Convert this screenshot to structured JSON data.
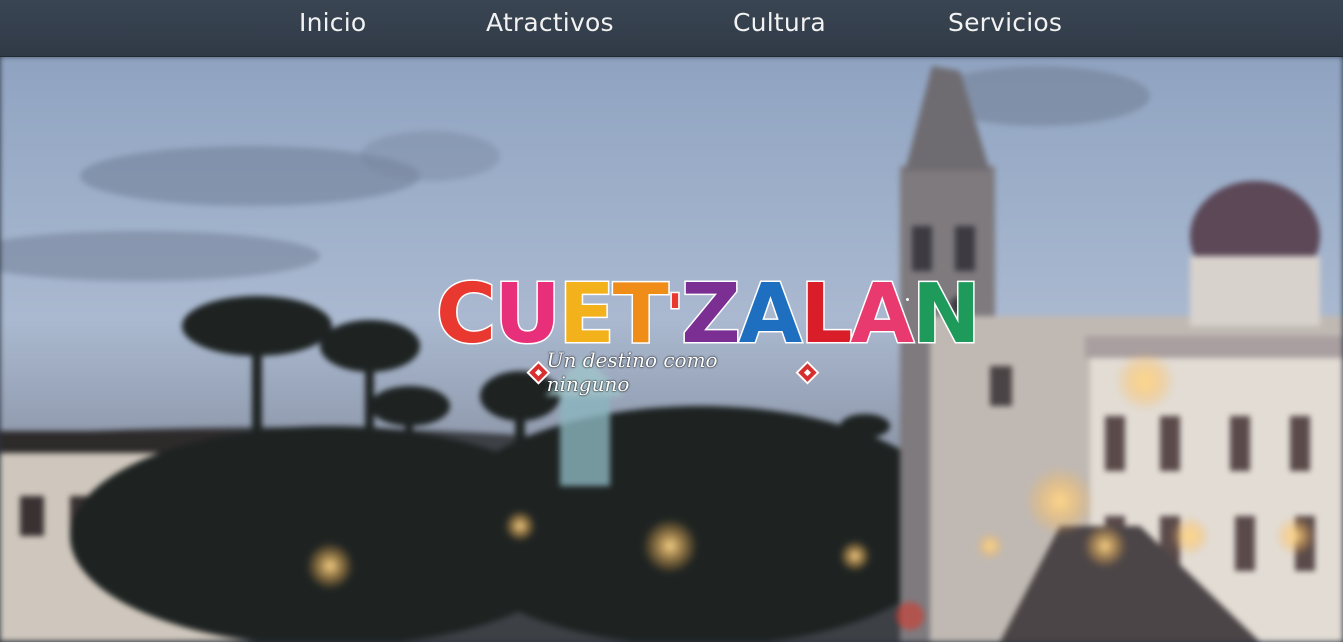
{
  "nav": {
    "items": [
      {
        "label": "Inicio"
      },
      {
        "label": "Atractivos"
      },
      {
        "label": "Cultura"
      },
      {
        "label": "Servicios"
      }
    ]
  },
  "hero": {
    "logo": {
      "letters": [
        "C",
        "U",
        "E",
        "T",
        "'",
        "Z",
        "A",
        "L",
        "A",
        "N"
      ],
      "letter_colors": [
        "#e8382f",
        "#e72f7a",
        "#f3b21c",
        "#f08d19",
        "#e8382f",
        "#7b2f93",
        "#1f6fc0",
        "#d91e2a",
        "#e83a6e",
        "#1e9a5a"
      ],
      "tagline": "Un destino como ninguno"
    }
  },
  "colors": {
    "nav_bg": "#353f4c",
    "nav_text": "#f2f2f2",
    "diamond": "#d72f30"
  }
}
